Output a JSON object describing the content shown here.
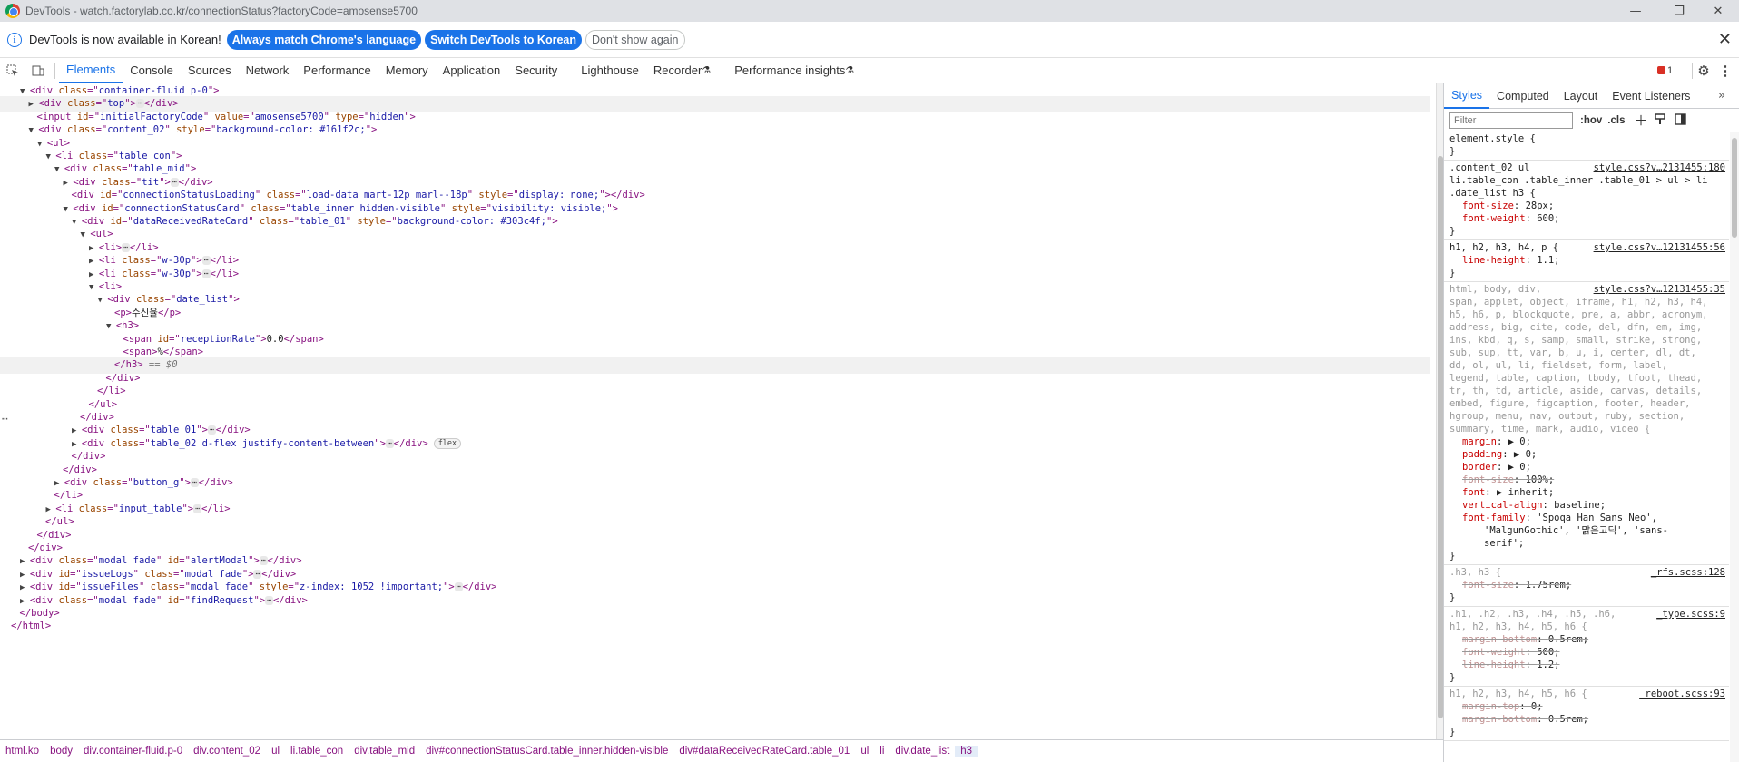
{
  "window": {
    "title": "DevTools - watch.factorylab.co.kr/connectionStatus?factoryCode=amosense5700"
  },
  "infobar": {
    "message": "DevTools is now available in Korean!",
    "btn_match": "Always match Chrome's language",
    "btn_switch": "Switch DevTools to Korean",
    "btn_dont_show": "Don't show again"
  },
  "tabs": [
    "Elements",
    "Console",
    "Sources",
    "Network",
    "Performance",
    "Memory",
    "Application",
    "Security",
    "Lighthouse",
    "Recorder",
    "Performance insights"
  ],
  "active_tab": "Elements",
  "issues_count": "1",
  "dom": [
    {
      "d": 2,
      "tri": "open",
      "h": [
        [
          "t",
          "<div "
        ],
        [
          "a",
          "class"
        ],
        [
          "t",
          "=\""
        ],
        [
          "v",
          "container-fluid p-0"
        ],
        [
          "t",
          "\">"
        ]
      ]
    },
    {
      "d": 3,
      "tri": "closed",
      "hl": true,
      "h": [
        [
          "t",
          "<div "
        ],
        [
          "a",
          "class"
        ],
        [
          "t",
          "=\""
        ],
        [
          "v",
          "top"
        ],
        [
          "t",
          "\">"
        ],
        [
          "dots",
          ""
        ],
        [
          "t",
          "</div>"
        ]
      ]
    },
    {
      "d": 3,
      "tri": "none",
      "h": [
        [
          "t",
          "<input "
        ],
        [
          "a",
          "id"
        ],
        [
          "t",
          "=\""
        ],
        [
          "v",
          "initialFactoryCode"
        ],
        [
          "t",
          "\" "
        ],
        [
          "a",
          "value"
        ],
        [
          "t",
          "=\""
        ],
        [
          "v",
          "amosense5700"
        ],
        [
          "t",
          "\" "
        ],
        [
          "a",
          "type"
        ],
        [
          "t",
          "=\""
        ],
        [
          "v",
          "hidden"
        ],
        [
          "t",
          "\">"
        ]
      ]
    },
    {
      "d": 3,
      "tri": "open",
      "h": [
        [
          "t",
          "<div "
        ],
        [
          "a",
          "class"
        ],
        [
          "t",
          "=\""
        ],
        [
          "v",
          "content_02"
        ],
        [
          "t",
          "\" "
        ],
        [
          "a",
          "style"
        ],
        [
          "t",
          "=\""
        ],
        [
          "v",
          "background-color: #161f2c;"
        ],
        [
          "t",
          "\">"
        ]
      ]
    },
    {
      "d": 4,
      "tri": "open",
      "h": [
        [
          "t",
          "<ul>"
        ]
      ]
    },
    {
      "d": 5,
      "tri": "open",
      "h": [
        [
          "t",
          "<li "
        ],
        [
          "a",
          "class"
        ],
        [
          "t",
          "=\""
        ],
        [
          "v",
          "table_con"
        ],
        [
          "t",
          "\">"
        ]
      ]
    },
    {
      "d": 6,
      "tri": "open",
      "h": [
        [
          "t",
          "<div "
        ],
        [
          "a",
          "class"
        ],
        [
          "t",
          "=\""
        ],
        [
          "v",
          "table_mid"
        ],
        [
          "t",
          "\">"
        ]
      ]
    },
    {
      "d": 7,
      "tri": "closed",
      "h": [
        [
          "t",
          "<div "
        ],
        [
          "a",
          "class"
        ],
        [
          "t",
          "=\""
        ],
        [
          "v",
          "tit"
        ],
        [
          "t",
          "\">"
        ],
        [
          "dots",
          ""
        ],
        [
          "t",
          "</div>"
        ]
      ]
    },
    {
      "d": 7,
      "tri": "none",
      "h": [
        [
          "t",
          "<div "
        ],
        [
          "a",
          "id"
        ],
        [
          "t",
          "=\""
        ],
        [
          "v",
          "connectionStatusLoading"
        ],
        [
          "t",
          "\" "
        ],
        [
          "a",
          "class"
        ],
        [
          "t",
          "=\""
        ],
        [
          "v",
          "load-data mart-12p marl--18p"
        ],
        [
          "t",
          "\" "
        ],
        [
          "a",
          "style"
        ],
        [
          "t",
          "=\""
        ],
        [
          "v",
          "display: none;"
        ],
        [
          "t",
          "\"></div>"
        ]
      ]
    },
    {
      "d": 7,
      "tri": "open",
      "h": [
        [
          "t",
          "<div "
        ],
        [
          "a",
          "id"
        ],
        [
          "t",
          "=\""
        ],
        [
          "v",
          "connectionStatusCard"
        ],
        [
          "t",
          "\" "
        ],
        [
          "a",
          "class"
        ],
        [
          "t",
          "=\""
        ],
        [
          "v",
          "table_inner hidden-visible"
        ],
        [
          "t",
          "\" "
        ],
        [
          "a",
          "style"
        ],
        [
          "t",
          "=\""
        ],
        [
          "v",
          "visibility: visible;"
        ],
        [
          "t",
          "\">"
        ]
      ]
    },
    {
      "d": 8,
      "tri": "open",
      "h": [
        [
          "t",
          "<div "
        ],
        [
          "a",
          "id"
        ],
        [
          "t",
          "=\""
        ],
        [
          "v",
          "dataReceivedRateCard"
        ],
        [
          "t",
          "\" "
        ],
        [
          "a",
          "class"
        ],
        [
          "t",
          "=\""
        ],
        [
          "v",
          "table_01"
        ],
        [
          "t",
          "\" "
        ],
        [
          "a",
          "style"
        ],
        [
          "t",
          "=\""
        ],
        [
          "v",
          "background-color: #303c4f;"
        ],
        [
          "t",
          "\">"
        ]
      ]
    },
    {
      "d": 9,
      "tri": "open",
      "h": [
        [
          "t",
          "<ul>"
        ]
      ]
    },
    {
      "d": 10,
      "tri": "closed",
      "h": [
        [
          "t",
          "<li>"
        ],
        [
          "dots",
          ""
        ],
        [
          "t",
          "</li>"
        ]
      ]
    },
    {
      "d": 10,
      "tri": "closed",
      "h": [
        [
          "t",
          "<li "
        ],
        [
          "a",
          "class"
        ],
        [
          "t",
          "=\""
        ],
        [
          "v",
          "w-30p"
        ],
        [
          "t",
          "\">"
        ],
        [
          "dots",
          ""
        ],
        [
          "t",
          "</li>"
        ]
      ]
    },
    {
      "d": 10,
      "tri": "closed",
      "h": [
        [
          "t",
          "<li "
        ],
        [
          "a",
          "class"
        ],
        [
          "t",
          "=\""
        ],
        [
          "v",
          "w-30p"
        ],
        [
          "t",
          "\">"
        ],
        [
          "dots",
          ""
        ],
        [
          "t",
          "</li>"
        ]
      ]
    },
    {
      "d": 10,
      "tri": "open",
      "h": [
        [
          "t",
          "<li>"
        ]
      ]
    },
    {
      "d": 11,
      "tri": "open",
      "h": [
        [
          "t",
          "<div "
        ],
        [
          "a",
          "class"
        ],
        [
          "t",
          "=\""
        ],
        [
          "v",
          "date_list"
        ],
        [
          "t",
          "\">"
        ]
      ]
    },
    {
      "d": 12,
      "tri": "none",
      "h": [
        [
          "t",
          "<p>"
        ],
        [
          "x",
          "수신율"
        ],
        [
          "t",
          "</p>"
        ]
      ]
    },
    {
      "d": 12,
      "tri": "open",
      "h": [
        [
          "t",
          "<h3>"
        ]
      ]
    },
    {
      "d": 13,
      "tri": "none",
      "h": [
        [
          "t",
          "<span "
        ],
        [
          "a",
          "id"
        ],
        [
          "t",
          "=\""
        ],
        [
          "v",
          "receptionRate"
        ],
        [
          "t",
          "\">"
        ],
        [
          "x",
          "0.0"
        ],
        [
          "t",
          "</span>"
        ]
      ]
    },
    {
      "d": 13,
      "tri": "none",
      "h": [
        [
          "t",
          "<span>"
        ],
        [
          "x",
          "%"
        ],
        [
          "t",
          "</span>"
        ]
      ]
    },
    {
      "d": 12,
      "tri": "none",
      "sel": true,
      "h": [
        [
          "t",
          "</h3>"
        ],
        [
          "eq",
          " == $0"
        ]
      ]
    },
    {
      "d": 11,
      "tri": "none",
      "h": [
        [
          "t",
          "</div>"
        ]
      ]
    },
    {
      "d": 10,
      "tri": "none",
      "h": [
        [
          "t",
          "</li>"
        ]
      ]
    },
    {
      "d": 9,
      "tri": "none",
      "h": [
        [
          "t",
          "</ul>"
        ]
      ]
    },
    {
      "d": 8,
      "tri": "none",
      "h": [
        [
          "t",
          "</div>"
        ]
      ]
    },
    {
      "d": 8,
      "tri": "closed",
      "h": [
        [
          "t",
          "<div "
        ],
        [
          "a",
          "class"
        ],
        [
          "t",
          "=\""
        ],
        [
          "v",
          "table_01"
        ],
        [
          "t",
          "\">"
        ],
        [
          "dots",
          ""
        ],
        [
          "t",
          "</div>"
        ]
      ]
    },
    {
      "d": 8,
      "tri": "closed",
      "h": [
        [
          "t",
          "<div "
        ],
        [
          "a",
          "class"
        ],
        [
          "t",
          "=\""
        ],
        [
          "v",
          "table_02 d-flex justify-content-between"
        ],
        [
          "t",
          "\">"
        ],
        [
          "dots",
          ""
        ],
        [
          "t",
          "</div>"
        ],
        [
          "badge",
          "flex"
        ]
      ]
    },
    {
      "d": 7,
      "tri": "none",
      "h": [
        [
          "t",
          "</div>"
        ]
      ]
    },
    {
      "d": 6,
      "tri": "none",
      "h": [
        [
          "t",
          "</div>"
        ]
      ]
    },
    {
      "d": 6,
      "tri": "closed",
      "h": [
        [
          "t",
          "<div "
        ],
        [
          "a",
          "class"
        ],
        [
          "t",
          "=\""
        ],
        [
          "v",
          "button_g"
        ],
        [
          "t",
          "\">"
        ],
        [
          "dots",
          ""
        ],
        [
          "t",
          "</div>"
        ]
      ]
    },
    {
      "d": 5,
      "tri": "none",
      "h": [
        [
          "t",
          "</li>"
        ]
      ]
    },
    {
      "d": 5,
      "tri": "closed",
      "h": [
        [
          "t",
          "<li "
        ],
        [
          "a",
          "class"
        ],
        [
          "t",
          "=\""
        ],
        [
          "v",
          "input_table"
        ],
        [
          "t",
          "\">"
        ],
        [
          "dots",
          ""
        ],
        [
          "t",
          "</li>"
        ]
      ]
    },
    {
      "d": 4,
      "tri": "none",
      "h": [
        [
          "t",
          "</ul>"
        ]
      ]
    },
    {
      "d": 3,
      "tri": "none",
      "h": [
        [
          "t",
          "</div>"
        ]
      ]
    },
    {
      "d": 2,
      "tri": "none",
      "h": [
        [
          "t",
          "</div>"
        ]
      ]
    },
    {
      "d": 2,
      "tri": "closed",
      "h": [
        [
          "t",
          "<div "
        ],
        [
          "a",
          "class"
        ],
        [
          "t",
          "=\""
        ],
        [
          "v",
          "modal fade"
        ],
        [
          "t",
          "\" "
        ],
        [
          "a",
          "id"
        ],
        [
          "t",
          "=\""
        ],
        [
          "v",
          "alertModal"
        ],
        [
          "t",
          "\">"
        ],
        [
          "dots",
          ""
        ],
        [
          "t",
          "</div>"
        ]
      ]
    },
    {
      "d": 2,
      "tri": "closed",
      "h": [
        [
          "t",
          "<div "
        ],
        [
          "a",
          "id"
        ],
        [
          "t",
          "=\""
        ],
        [
          "v",
          "issueLogs"
        ],
        [
          "t",
          "\" "
        ],
        [
          "a",
          "class"
        ],
        [
          "t",
          "=\""
        ],
        [
          "v",
          "modal fade"
        ],
        [
          "t",
          "\">"
        ],
        [
          "dots",
          ""
        ],
        [
          "t",
          "</div>"
        ]
      ]
    },
    {
      "d": 2,
      "tri": "closed",
      "h": [
        [
          "t",
          "<div "
        ],
        [
          "a",
          "id"
        ],
        [
          "t",
          "=\""
        ],
        [
          "v",
          "issueFiles"
        ],
        [
          "t",
          "\" "
        ],
        [
          "a",
          "class"
        ],
        [
          "t",
          "=\""
        ],
        [
          "v",
          "modal fade"
        ],
        [
          "t",
          "\" "
        ],
        [
          "a",
          "style"
        ],
        [
          "t",
          "=\""
        ],
        [
          "v",
          "z-index: 1052 !important;"
        ],
        [
          "t",
          "\">"
        ],
        [
          "dots",
          ""
        ],
        [
          "t",
          "</div>"
        ]
      ]
    },
    {
      "d": 2,
      "tri": "closed",
      "h": [
        [
          "t",
          "<div "
        ],
        [
          "a",
          "class"
        ],
        [
          "t",
          "=\""
        ],
        [
          "v",
          "modal fade"
        ],
        [
          "t",
          "\" "
        ],
        [
          "a",
          "id"
        ],
        [
          "t",
          "=\""
        ],
        [
          "v",
          "findRequest"
        ],
        [
          "t",
          "\">"
        ],
        [
          "dots",
          ""
        ],
        [
          "t",
          "</div>"
        ]
      ]
    },
    {
      "d": 1,
      "tri": "none",
      "h": [
        [
          "t",
          "</body>"
        ]
      ]
    },
    {
      "d": 0,
      "tri": "none",
      "h": [
        [
          "t",
          "</html>"
        ]
      ]
    }
  ],
  "breadcrumbs": [
    "html.ko",
    "body",
    "div.container-fluid.p-0",
    "div.content_02",
    "ul",
    "li.table_con",
    "div.table_mid",
    "div#connectionStatusCard.table_inner.hidden-visible",
    "div#dataReceivedRateCard.table_01",
    "ul",
    "li",
    "div.date_list",
    "h3"
  ],
  "side_tabs": [
    "Styles",
    "Computed",
    "Layout",
    "Event Listeners"
  ],
  "filter_placeholder": "Filter",
  "filter_tools": [
    ":hov",
    ".cls"
  ],
  "styles": [
    {
      "sel": "element.style {",
      "src": "",
      "props": []
    },
    {
      "sel": ".content_02 ul",
      "sel2": "li.table_con .table_inner .table_01 > ul > li",
      "sel3": ".date_list h3 {",
      "src": "style.css?v…2131455:180",
      "props": [
        [
          "font-size",
          "28px",
          false
        ],
        [
          "font-weight",
          "600",
          false
        ]
      ]
    },
    {
      "sel": "h1, h2, h3, h4, p {",
      "src": "style.css?v…12131455:56",
      "props": [
        [
          "line-height",
          "1.1",
          false
        ]
      ]
    },
    {
      "sel": "html, body, div,",
      "sel_long": [
        "span, applet, object, iframe, h1, h2, h3, h4,",
        "h5, h6, p, blockquote, pre, a, abbr, acronym,",
        "address, big, cite, code, del, dfn, em, img,",
        "ins, kbd, q, s, samp, small, strike, strong,",
        "sub, sup, tt, var, b, u, i, center, dl, dt,",
        "dd, ol, ul, li, fieldset, form, label,",
        "legend, table, caption, tbody, tfoot, thead,",
        "tr, th, td, article, aside, canvas, details,",
        "embed, figure, figcaption, footer, header,",
        "hgroup, menu, nav, output, ruby, section,",
        "summary, time, mark, audio, video {"
      ],
      "src": "style.css?v…12131455:35",
      "props": [
        [
          "margin",
          "▶ 0",
          false
        ],
        [
          "padding",
          "▶ 0",
          false
        ],
        [
          "border",
          "▶ 0",
          false
        ],
        [
          "font-size",
          "100%",
          true
        ],
        [
          "font",
          "▶ inherit",
          false
        ],
        [
          "vertical-align",
          "baseline",
          false
        ],
        [
          "font-family",
          "'Spoqa Han Sans Neo',",
          false
        ]
      ],
      "cont": [
        "'MalgunGothic', '맑은고딕', 'sans-",
        "serif';"
      ]
    },
    {
      "sel": ".h3, h3 {",
      "src": "_rfs.scss:128",
      "props": [
        [
          "font-size",
          "1.75rem",
          true
        ]
      ]
    },
    {
      "sel": ".h1, .h2, .h3, .h4, .h5, .h6,",
      "sel2": "h1, h2, h3, h4, h5, h6 {",
      "src": "_type.scss:9",
      "props": [
        [
          "margin-bottom",
          "0.5rem",
          true
        ],
        [
          "font-weight",
          "500",
          true
        ],
        [
          "line-height",
          "1.2",
          true
        ]
      ]
    },
    {
      "sel": "h1, h2, h3, h4, h5, h6 {",
      "src": "_reboot.scss:93",
      "props": [
        [
          "margin-top",
          "0",
          true
        ],
        [
          "margin-bottom",
          "0.5rem",
          true
        ]
      ]
    }
  ]
}
